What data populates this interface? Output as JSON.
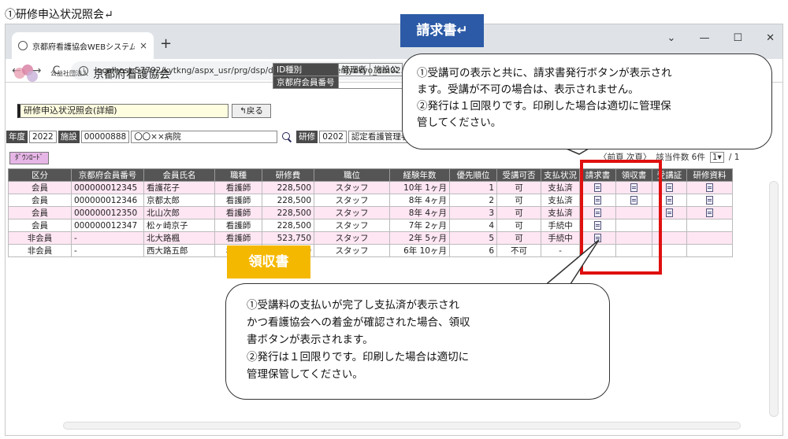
{
  "doc_title": "①研修申込状況照会↵",
  "browser": {
    "tab_title": "京都府看護協会WEBシステム",
    "tab_close": "×",
    "new_tab": "+",
    "win_min": "⌄",
    "win_minimize": "—",
    "win_max": "☐",
    "win_close": "✕",
    "back": "←",
    "forward": "→",
    "reload": "C",
    "url": "localhost:57792/kytkng/aspx_usr/prg/dsp/d_kenjyokyo/d_kenjyokyo_dm02.aspx"
  },
  "app": {
    "org_small": "公益社団法人",
    "org_name": "京都府看護協会",
    "id_type_label": "ID種別",
    "id_type_value": "管理者",
    "id_type_extra": "施設公",
    "member_no_label": "京都府会員番号",
    "screen_title": "研修申込状況照会(詳細)",
    "back_label": "戻る"
  },
  "filter": {
    "year_label": "年度",
    "year_value": "2022",
    "facility_label": "施設",
    "facility_code": "00000888",
    "facility_name": "〇〇××病院",
    "training_label": "研修",
    "training_code": "0202",
    "training_name": "認定看護管理者"
  },
  "download_label": "ﾀﾞｳﾝﾛｰﾄﾞ",
  "pager": {
    "nav": "〈前頁  次頁〉",
    "count": "該当件数 6件",
    "page_select": "1▾",
    "total": "/ 1"
  },
  "table": {
    "headers": [
      "区分",
      "京都府会員番号",
      "会員氏名",
      "職種",
      "研修費",
      "職位",
      "経験年数",
      "優先順位",
      "受講可否",
      "支払状況",
      "請求書",
      "領収書",
      "受講証",
      "研修資料"
    ],
    "rows": [
      {
        "kubun": "会員",
        "no": "000000012345",
        "name": "看護花子",
        "job": "看護師",
        "fee": "228,500",
        "pos": "スタッフ",
        "exp": "10年 1ヶ月",
        "prio": "1",
        "ok": "可",
        "pay": "支払済",
        "inv": true,
        "rec": true,
        "cert": true,
        "mat": true
      },
      {
        "kubun": "会員",
        "no": "000000012346",
        "name": "京都太郎",
        "job": "看護師",
        "fee": "228,500",
        "pos": "スタッフ",
        "exp": "8年 4ヶ月",
        "prio": "2",
        "ok": "可",
        "pay": "支払済",
        "inv": true,
        "rec": true,
        "cert": true,
        "mat": true
      },
      {
        "kubun": "会員",
        "no": "000000012350",
        "name": "北山次郎",
        "job": "看護師",
        "fee": "228,500",
        "pos": "スタッフ",
        "exp": "8年 4ヶ月",
        "prio": "3",
        "ok": "可",
        "pay": "支払済",
        "inv": true,
        "rec": false,
        "cert": true,
        "mat": true
      },
      {
        "kubun": "会員",
        "no": "000000012347",
        "name": "松ヶ崎京子",
        "job": "看護師",
        "fee": "228,500",
        "pos": "スタッフ",
        "exp": "7年 2ヶ月",
        "prio": "4",
        "ok": "可",
        "pay": "手続中",
        "inv": true,
        "rec": false,
        "cert": false,
        "mat": false
      },
      {
        "kubun": "非会員",
        "no": "-",
        "name": "北大路楓",
        "job": "看護師",
        "fee": "523,750",
        "pos": "スタッフ",
        "exp": "2年 5ヶ月",
        "prio": "5",
        "ok": "可",
        "pay": "手続中",
        "inv": true,
        "rec": false,
        "cert": false,
        "mat": false
      },
      {
        "kubun": "非会員",
        "no": "-",
        "name": "西大路五郎",
        "job": "看護師",
        "fee": "523,750",
        "pos": "スタッフ",
        "exp": "6年 10ヶ月",
        "prio": "6",
        "ok": "不可",
        "pay": "-",
        "inv": false,
        "rec": false,
        "cert": false,
        "mat": false
      }
    ]
  },
  "annotations": {
    "invoice_tag": "請求書↵",
    "receipt_tag": "領収書",
    "invoice_lines": [
      "①受講可の表示と共に、請求書発行ボタンが表示され",
      "ます。受講が不可の場合は、表示されません。",
      "②発行は１回限りです。印刷した場合は適切に管理保",
      "管してください。"
    ],
    "receipt_lines": [
      "①受講料の支払いが完了し支払済が表示され",
      "かつ看護協会への着金が確認された場合、領収",
      "書ボタンが表示されます。",
      "②発行は１回限りです。印刷した場合は適切に",
      "管理保管してください。"
    ],
    "highlight_color": "#e01010",
    "invoice_tag_color": "#2c5aa6",
    "receipt_tag_color": "#f5b800"
  }
}
